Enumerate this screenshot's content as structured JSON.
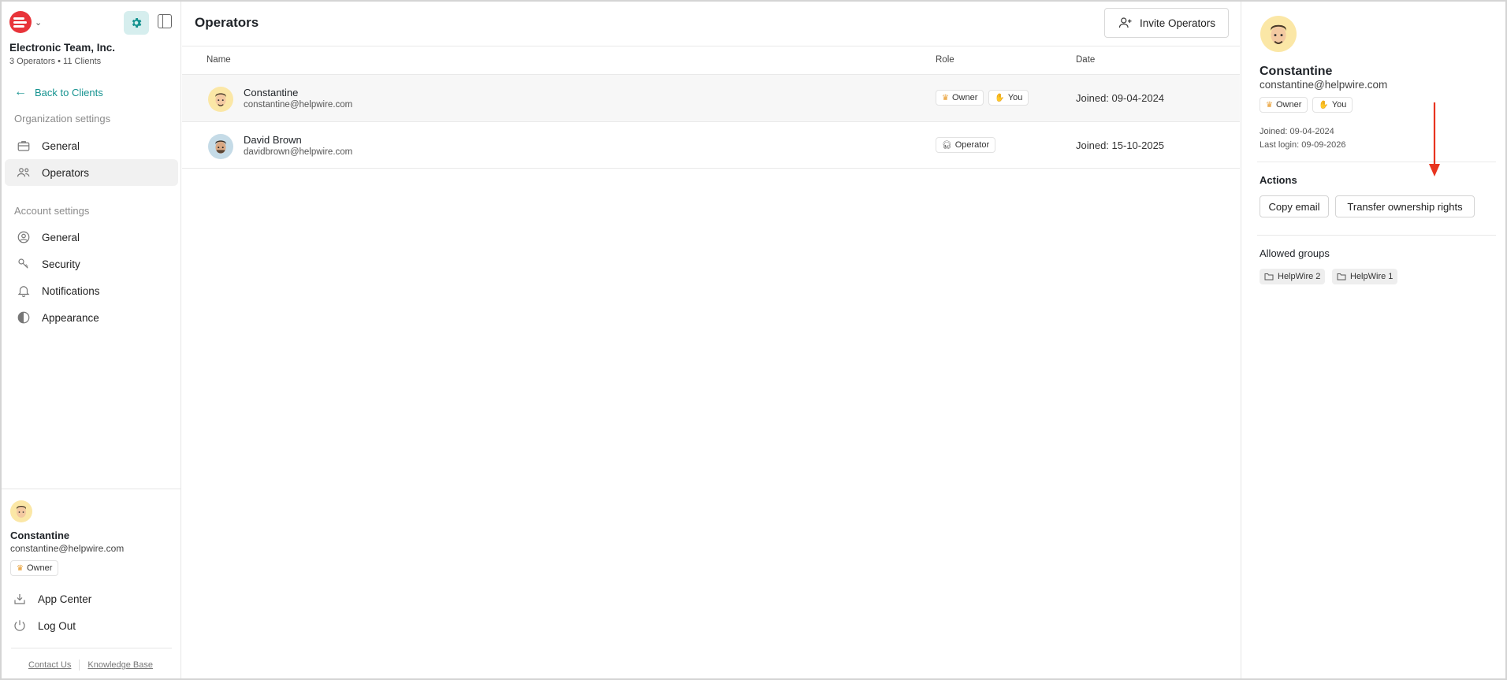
{
  "sidebar": {
    "org_name": "Electronic Team, Inc.",
    "org_meta": "3 Operators • 11 Clients",
    "back_label": "Back to Clients",
    "org_section": "Organization settings",
    "org_items": [
      {
        "label": "General",
        "icon": "briefcase-icon"
      },
      {
        "label": "Operators",
        "icon": "users-icon"
      }
    ],
    "account_section": "Account settings",
    "account_items": [
      {
        "label": "General",
        "icon": "user-circle-icon"
      },
      {
        "label": "Security",
        "icon": "shield-key-icon"
      },
      {
        "label": "Notifications",
        "icon": "bell-icon"
      },
      {
        "label": "Appearance",
        "icon": "contrast-icon"
      }
    ],
    "user": {
      "name": "Constantine",
      "email": "constantine@helpwire.com",
      "role": "Owner"
    },
    "app_center": "App Center",
    "log_out": "Log Out",
    "contact_us": "Contact Us",
    "knowledge_base": "Knowledge Base"
  },
  "main": {
    "title": "Operators",
    "invite_label": "Invite Operators",
    "columns": {
      "name": "Name",
      "role": "Role",
      "date": "Date"
    },
    "rows": [
      {
        "name": "Constantine",
        "email": "constantine@helpwire.com",
        "roles": [
          "Owner",
          "You"
        ],
        "date": "Joined: 09-04-2024",
        "selected": true
      },
      {
        "name": "David Brown",
        "email": "davidbrown@helpwire.com",
        "roles": [
          "Operator"
        ],
        "date": "Joined: 15-10-2025",
        "selected": false
      }
    ]
  },
  "detail": {
    "name": "Constantine",
    "email": "constantine@helpwire.com",
    "badges": [
      "Owner",
      "You"
    ],
    "joined": "Joined: 09-04-2024",
    "last_login": "Last login: 09-09-2026",
    "actions_heading": "Actions",
    "copy_email": "Copy email",
    "transfer": "Transfer ownership rights",
    "groups_heading": "Allowed groups",
    "groups": [
      "HelpWire 2",
      "HelpWire 1"
    ]
  },
  "colors": {
    "accent": "#14928f",
    "brand": "#e8343a",
    "annotation_arrow": "#e8341f"
  }
}
